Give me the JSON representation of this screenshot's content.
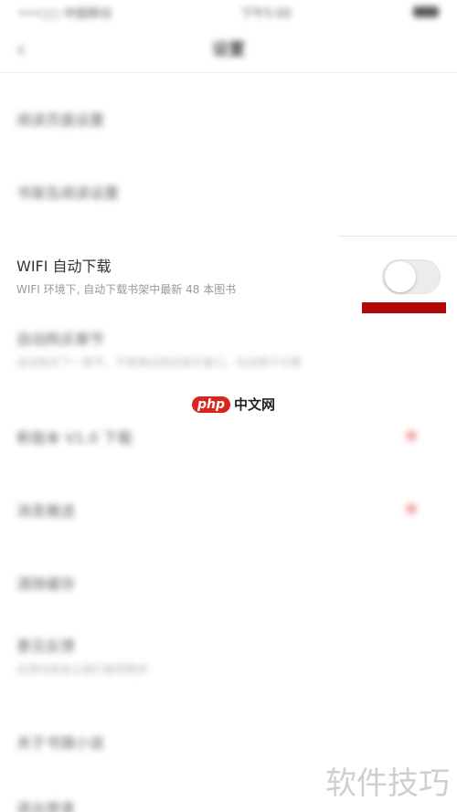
{
  "status_bar": {
    "carrier": "•••○○ 中国移动",
    "time": "下午5:00"
  },
  "nav": {
    "title": "设置"
  },
  "rows": [
    {
      "id": "row1",
      "title": "阅读页面设置",
      "subtitle": ""
    },
    {
      "id": "row2",
      "title": "书架及阅读设置",
      "subtitle": ""
    },
    {
      "id": "row4",
      "title": "自动购买章节",
      "subtitle": "自动购买下一章节，不再弹出购买提示窗口，仅适用于付费"
    },
    {
      "id": "row5",
      "title": "新版本 V1.0 下载",
      "subtitle": ""
    },
    {
      "id": "row6",
      "title": "消息推送",
      "subtitle": ""
    },
    {
      "id": "row7",
      "title": "清除缓存",
      "subtitle": ""
    },
    {
      "id": "row8",
      "title": "意见反馈",
      "subtitle": "反馈内容会让我们做得更好"
    },
    {
      "id": "row9",
      "title": "关于书旗小说",
      "subtitle": ""
    },
    {
      "id": "row10",
      "title": "退出登录",
      "subtitle": ""
    }
  ],
  "wifi_setting": {
    "title": "WIFI 自动下载",
    "subtitle": "WIFI 环境下, 自动下载书架中最新 48 本图书",
    "enabled": false
  },
  "watermark": {
    "logo": "php",
    "site": "中文网",
    "bottom": "软件技巧"
  },
  "colors": {
    "highlight": "#b30606",
    "badge": "#f08a8a",
    "php_red": "#d9251c"
  }
}
